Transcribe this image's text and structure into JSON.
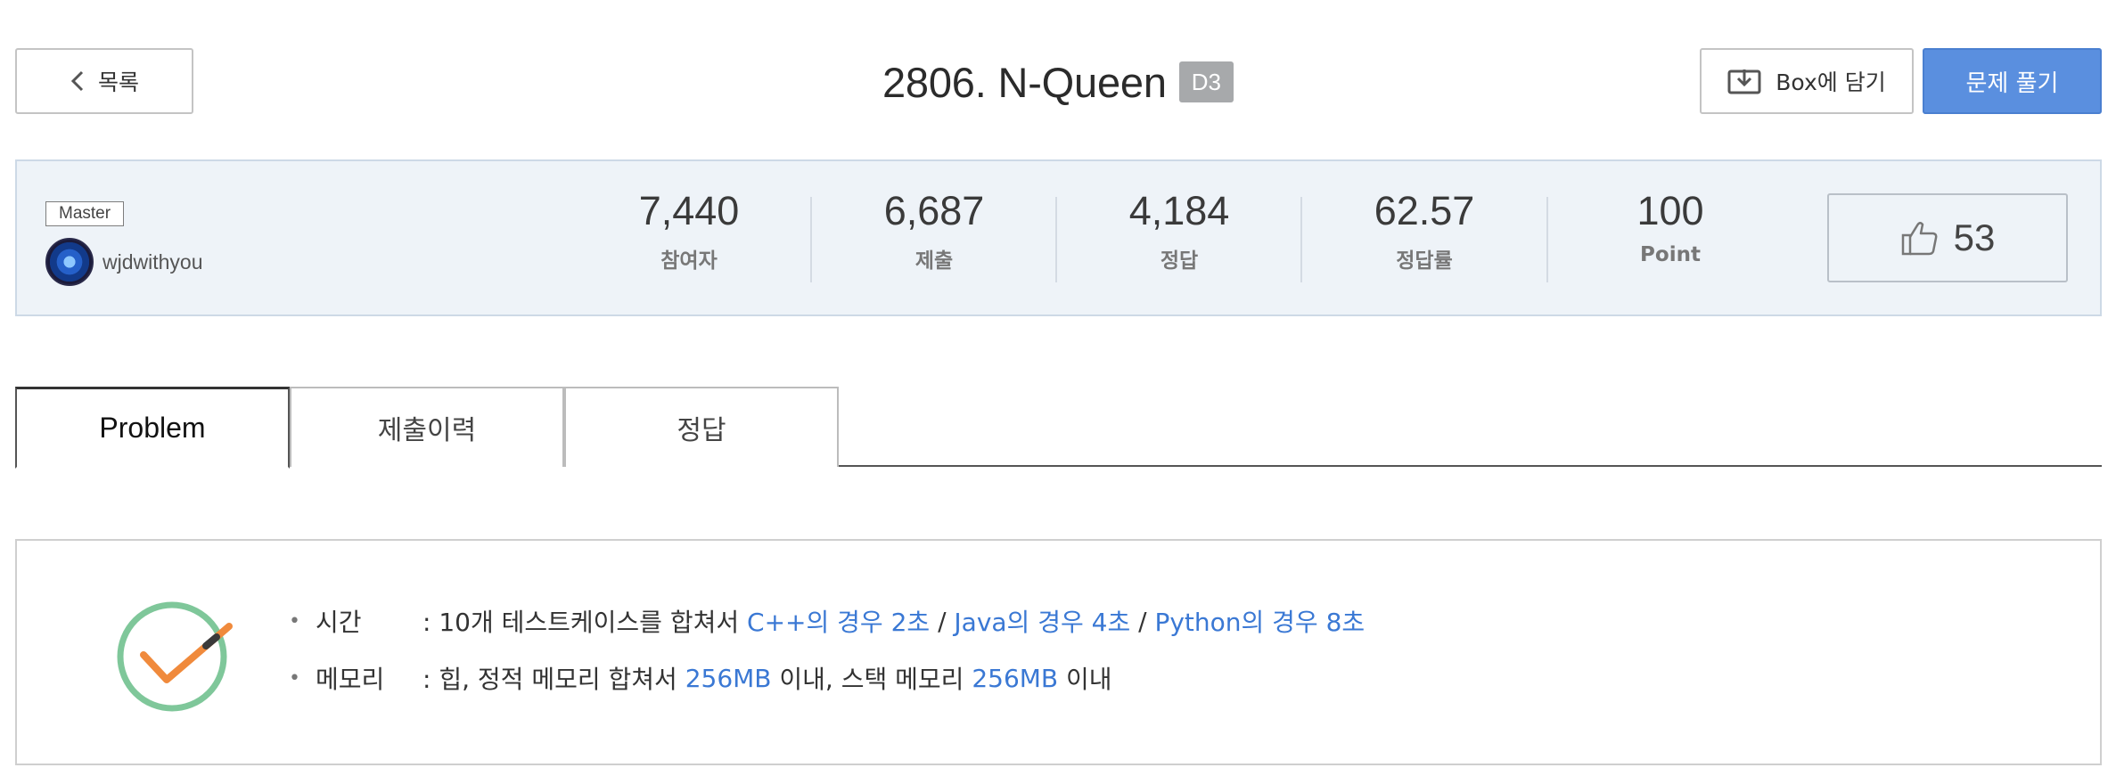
{
  "header": {
    "back_label": "목록",
    "title": "2806. N-Queen",
    "level": "D3",
    "box_label": "Box에 담기",
    "solve_label": "문제 풀기"
  },
  "author": {
    "tag": "Master",
    "name": "wjdwithyou"
  },
  "stats": [
    {
      "value": "7,440",
      "label": "참여자"
    },
    {
      "value": "6,687",
      "label": "제출"
    },
    {
      "value": "4,184",
      "label": "정답"
    },
    {
      "value": "62.57",
      "label": "정답률"
    },
    {
      "value": "100",
      "label": "Point"
    }
  ],
  "likes": "53",
  "tabs": [
    {
      "label": "Problem",
      "active": true
    },
    {
      "label": "제출이력",
      "active": false
    },
    {
      "label": "정답",
      "active": false
    }
  ],
  "constraints": {
    "time": {
      "label": "시간",
      "prefix": ": 10개 테스트케이스를 합쳐서 ",
      "cpp": "C++의 경우 2초",
      "slash1": " / ",
      "java": "Java의 경우 4초",
      "slash2": " / ",
      "python": "Python의 경우 8초"
    },
    "memory": {
      "label": "메모리",
      "prefix": ": 힙, 정적 메모리 합쳐서 ",
      "heap": "256MB",
      "mid": " 이내, 스택 메모리 ",
      "stack": "256MB",
      "suffix": " 이내"
    }
  },
  "colors": {
    "accent": "#5a8fdf",
    "highlight": "#3a78d4",
    "panel_bg": "#eef3f8",
    "check_ring": "#7fc79a",
    "check_mark": "#f08a3c"
  },
  "icons": [
    "chevron-left-icon",
    "download-box-icon",
    "thumbs-up-icon",
    "check-circle-icon"
  ]
}
